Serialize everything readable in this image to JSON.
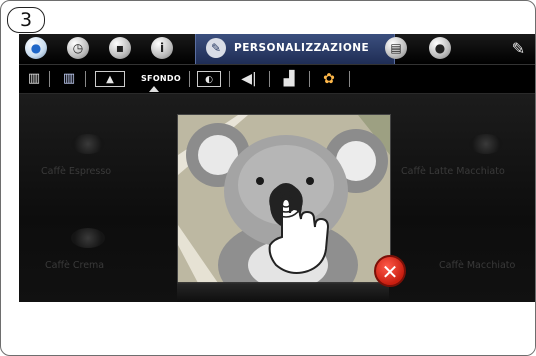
{
  "step": {
    "number": "3"
  },
  "topbar": {
    "active_tab_label": "PERSONALIZZAZIONE",
    "icons": [
      "water-drop-icon",
      "clock-icon",
      "cup-icon",
      "info-icon",
      "pencil-icon",
      "screen-icon",
      "user-icon",
      "wrench-icon"
    ]
  },
  "subbar": {
    "active_label": "SFONDO",
    "icons": [
      "book-icon",
      "book-colored-icon",
      "image-icon",
      "screen-saver-icon",
      "speaker-icon",
      "boot-icon",
      "palette-icon"
    ]
  },
  "background_tiles": [
    {
      "label": "Caffè Espresso"
    },
    {
      "label": "Caffè Crema"
    },
    {
      "label": "Caffè Macchiato"
    },
    {
      "label": "Caffè Latte Macchiato"
    }
  ],
  "colors": {
    "accent_tab": "#2a3a66",
    "close_button": "#d22a1c"
  }
}
